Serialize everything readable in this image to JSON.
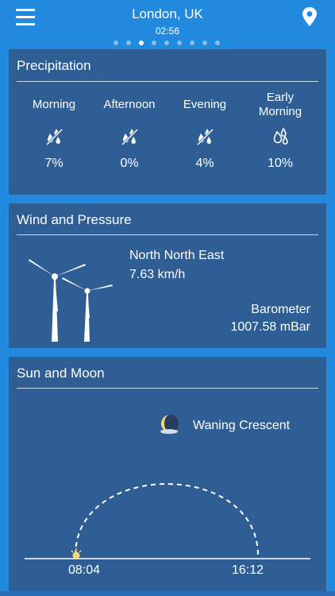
{
  "header": {
    "location": "London, UK",
    "time": "02:56",
    "page_count": 9,
    "active_page_index": 2
  },
  "precipitation": {
    "title": "Precipitation",
    "periods": [
      {
        "label": "Morning",
        "value": "7%",
        "icon": "rain-drops-crossed-icon"
      },
      {
        "label": "Afternoon",
        "value": "0%",
        "icon": "rain-drops-crossed-icon"
      },
      {
        "label": "Evening",
        "value": "4%",
        "icon": "rain-drops-crossed-icon"
      },
      {
        "label": "Early Morning",
        "value": "10%",
        "icon": "rain-drops-icon"
      }
    ]
  },
  "wind": {
    "title": "Wind and Pressure",
    "direction": "North North East",
    "speed": "7.63 km/h",
    "pressure_label": "Barometer",
    "pressure_value": "1007.58 mBar"
  },
  "sun_moon": {
    "title": "Sun and Moon",
    "moon_phase": "Waning Crescent",
    "sunrise": "08:04",
    "sunset": "16:12"
  },
  "colors": {
    "background": "#2189de",
    "card": "#2e5e94",
    "text": "#ffffff",
    "inactive_dot": "#88bde8"
  }
}
